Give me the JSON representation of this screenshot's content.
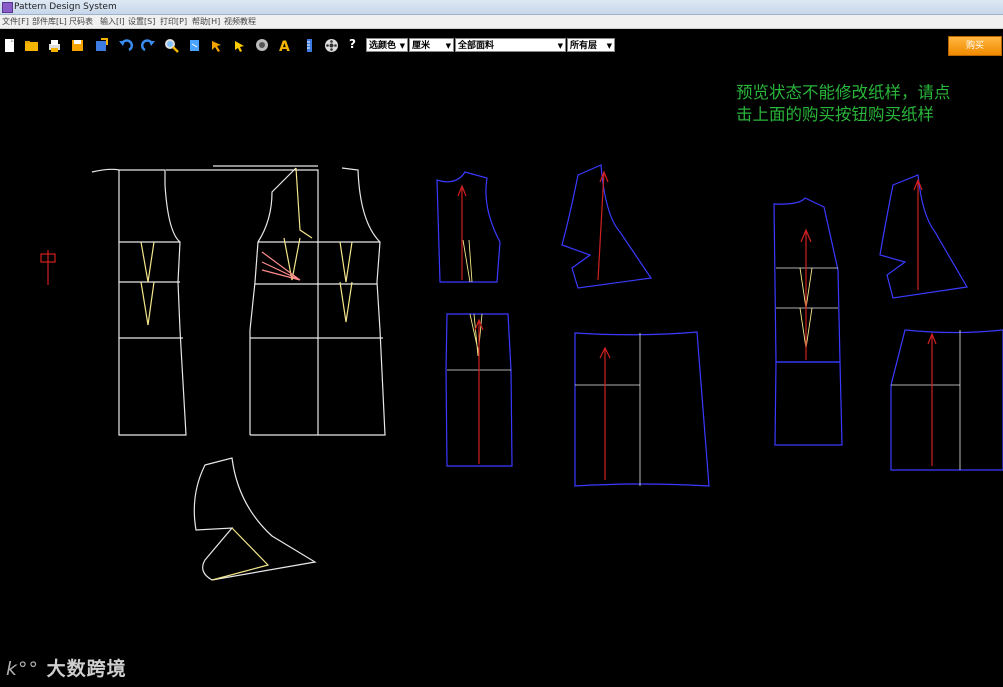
{
  "window": {
    "title": "Pattern Design System"
  },
  "menu": {
    "items": [
      {
        "label": "文件[F]"
      },
      {
        "label": "部件库[L]"
      },
      {
        "label": "尺码表"
      },
      {
        "label": "输入[I]"
      },
      {
        "label": "设置[S]"
      },
      {
        "label": "打印[P]"
      },
      {
        "label": "帮助[H]"
      },
      {
        "label": "视频教程"
      }
    ]
  },
  "toolbar": {
    "icons": [
      "new-file-icon",
      "open-folder-icon",
      "print-icon",
      "save-icon",
      "export-icon",
      "undo-icon",
      "redo-icon",
      "zoom-icon",
      "rotate-icon",
      "pointer-icon",
      "select-arrow-icon",
      "measure-icon",
      "text-icon",
      "ruler-icon",
      "film-icon"
    ],
    "help_label": "?",
    "color_select": "选颜色",
    "unit_select": "厘米",
    "fabric_select": "全部面料",
    "layer_select": "所有层",
    "buy_label": "购买"
  },
  "notice": {
    "line1": "预览状态不能修改纸样，请点",
    "line2": "击上面的购买按钮购买纸样"
  },
  "watermark": {
    "logo": "k°°",
    "text": "大数跨境"
  },
  "colors": {
    "accent_buy": "#f39200",
    "notice": "#29b43a",
    "piece_outline_blue": "#3a3aff",
    "piece_outline_white": "#e8e8e8",
    "grain_red": "#d12020"
  }
}
